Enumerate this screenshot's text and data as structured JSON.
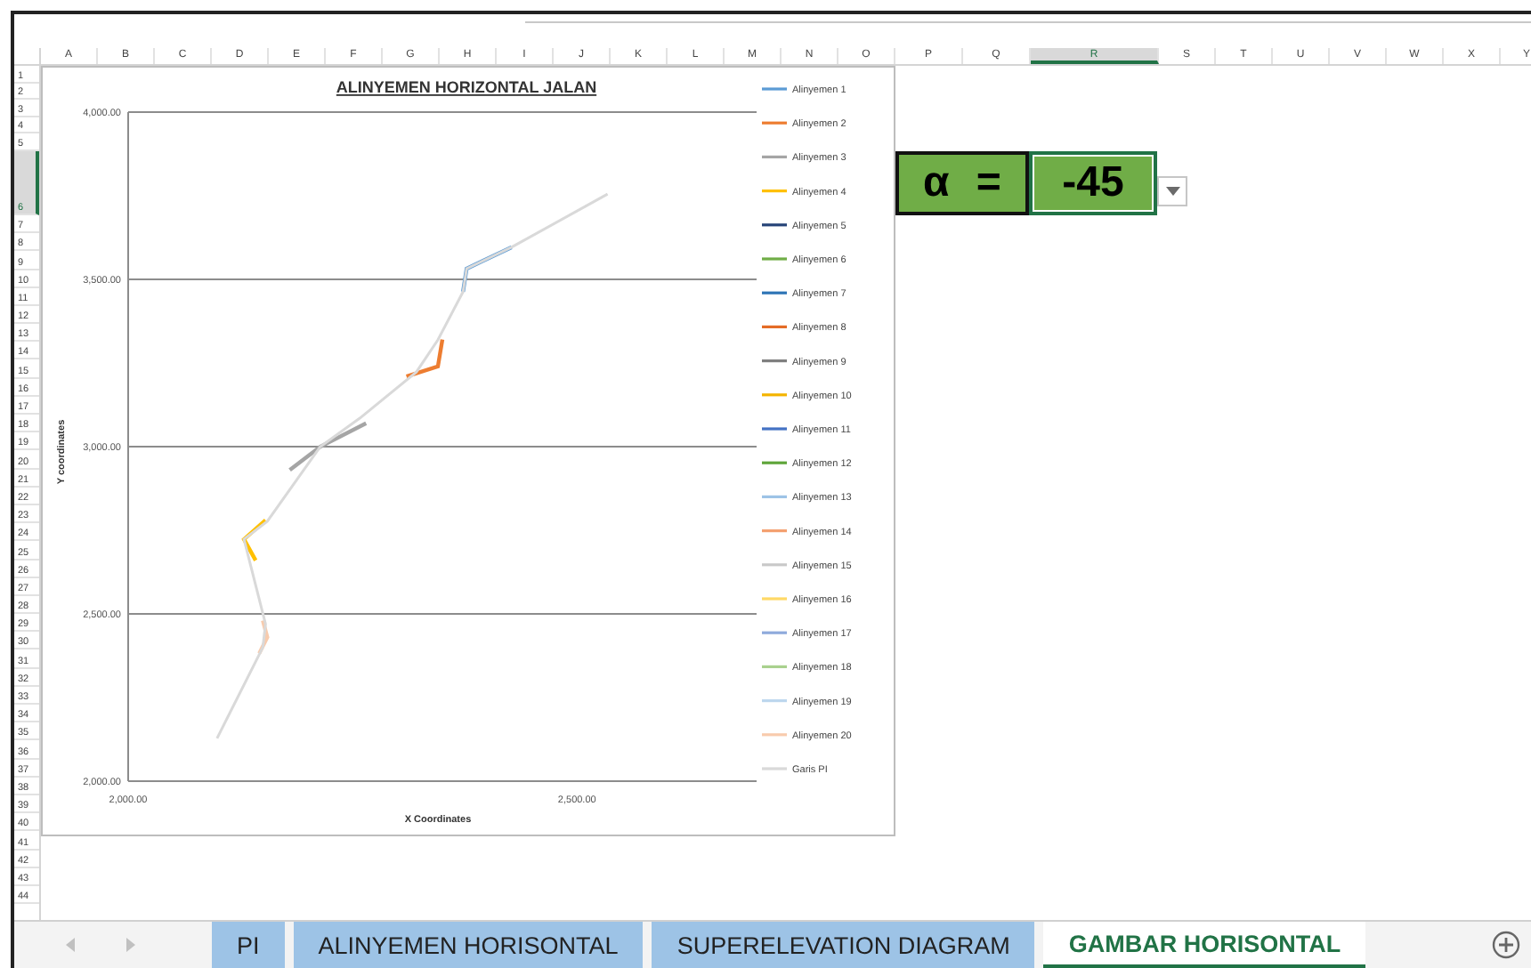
{
  "columns": [
    {
      "label": "A",
      "selected": false
    },
    {
      "label": "B",
      "selected": false
    },
    {
      "label": "C",
      "selected": false
    },
    {
      "label": "D",
      "selected": false
    },
    {
      "label": "E",
      "selected": false
    },
    {
      "label": "F",
      "selected": false
    },
    {
      "label": "G",
      "selected": false
    },
    {
      "label": "H",
      "selected": false
    },
    {
      "label": "I",
      "selected": false
    },
    {
      "label": "J",
      "selected": false
    },
    {
      "label": "K",
      "selected": false
    },
    {
      "label": "L",
      "selected": false
    },
    {
      "label": "M",
      "selected": false
    },
    {
      "label": "N",
      "selected": false
    },
    {
      "label": "O",
      "selected": false
    },
    {
      "label": "P",
      "selected": false
    },
    {
      "label": "Q",
      "selected": false
    },
    {
      "label": "R",
      "selected": true
    },
    {
      "label": "S",
      "selected": false
    },
    {
      "label": "T",
      "selected": false
    },
    {
      "label": "U",
      "selected": false
    },
    {
      "label": "V",
      "selected": false
    },
    {
      "label": "W",
      "selected": false
    },
    {
      "label": "X",
      "selected": false
    },
    {
      "label": "Y",
      "selected": false
    }
  ],
  "rows": [
    {
      "label": "1",
      "selected": false
    },
    {
      "label": "2",
      "selected": false
    },
    {
      "label": "3",
      "selected": false
    },
    {
      "label": "4",
      "selected": false
    },
    {
      "label": "5",
      "selected": false
    },
    {
      "label": "6",
      "selected": true
    },
    {
      "label": "7",
      "selected": false
    },
    {
      "label": "8",
      "selected": false
    },
    {
      "label": "9",
      "selected": false
    },
    {
      "label": "10",
      "selected": false
    },
    {
      "label": "11",
      "selected": false
    },
    {
      "label": "12",
      "selected": false
    },
    {
      "label": "13",
      "selected": false
    },
    {
      "label": "14",
      "selected": false
    },
    {
      "label": "15",
      "selected": false
    },
    {
      "label": "16",
      "selected": false
    },
    {
      "label": "17",
      "selected": false
    },
    {
      "label": "18",
      "selected": false
    },
    {
      "label": "19",
      "selected": false
    },
    {
      "label": "20",
      "selected": false
    },
    {
      "label": "21",
      "selected": false
    },
    {
      "label": "22",
      "selected": false
    },
    {
      "label": "23",
      "selected": false
    },
    {
      "label": "24",
      "selected": false
    },
    {
      "label": "25",
      "selected": false
    },
    {
      "label": "26",
      "selected": false
    },
    {
      "label": "27",
      "selected": false
    },
    {
      "label": "28",
      "selected": false
    },
    {
      "label": "29",
      "selected": false
    },
    {
      "label": "30",
      "selected": false
    },
    {
      "label": "31",
      "selected": false
    },
    {
      "label": "32",
      "selected": false
    },
    {
      "label": "33",
      "selected": false
    },
    {
      "label": "34",
      "selected": false
    },
    {
      "label": "35",
      "selected": false
    },
    {
      "label": "36",
      "selected": false
    },
    {
      "label": "37",
      "selected": false
    },
    {
      "label": "38",
      "selected": false
    },
    {
      "label": "39",
      "selected": false
    },
    {
      "label": "40",
      "selected": false
    },
    {
      "label": "41",
      "selected": false
    },
    {
      "label": "42",
      "selected": false
    },
    {
      "label": "43",
      "selected": false
    },
    {
      "label": "44",
      "selected": false
    }
  ],
  "chart": {
    "chart_data": {
      "type": "line",
      "grid": "y",
      "legend": "right",
      "title": "ALINYEMEN HORIZONTAL JALAN",
      "xlabel": "X Coordinates",
      "ylabel": "Y coordinates",
      "xlim": [
        2000,
        2700
      ],
      "ylim": [
        2000,
        4000
      ],
      "xticks": [
        {
          "value": 2000,
          "label": "2,000.00"
        },
        {
          "value": 2500,
          "label": "2,500.00"
        }
      ],
      "yticks": [
        {
          "value": 2000,
          "label": "2,000.00"
        },
        {
          "value": 2500,
          "label": "2,500.00"
        },
        {
          "value": 3000,
          "label": "3,000.00"
        },
        {
          "value": 3500,
          "label": "3,500.00"
        },
        {
          "value": 4000,
          "label": "4,000.00"
        }
      ],
      "series": [
        {
          "name": "Alinyemen 1",
          "color": "#5b9bd5",
          "x": [
            2373,
            2377,
            2395,
            2427
          ],
          "values": [
            3463,
            3532,
            3555,
            3596
          ]
        },
        {
          "name": "Alinyemen 2",
          "color": "#ed7d31",
          "x": [
            2310,
            2345,
            2350
          ],
          "values": [
            3210,
            3240,
            3320
          ]
        },
        {
          "name": "Alinyemen 3",
          "color": "#a5a5a5",
          "x": [
            2180,
            2214,
            2265
          ],
          "values": [
            2930,
            3000,
            3070
          ]
        },
        {
          "name": "Alinyemen 4",
          "color": "#ffc000",
          "x": [
            2153,
            2129,
            2142
          ],
          "values": [
            2780,
            2723,
            2660
          ]
        },
        {
          "name": "Alinyemen 5",
          "color": "#264478"
        },
        {
          "name": "Alinyemen 6",
          "color": "#70ad47"
        },
        {
          "name": "Alinyemen 7",
          "color": "#2e75b6"
        },
        {
          "name": "Alinyemen 8",
          "color": "#e46c26"
        },
        {
          "name": "Alinyemen 9",
          "color": "#7f7f7f"
        },
        {
          "name": "Alinyemen 10",
          "color": "#f4b400"
        },
        {
          "name": "Alinyemen 11",
          "color": "#4472c4"
        },
        {
          "name": "Alinyemen 12",
          "color": "#5fa53a"
        },
        {
          "name": "Alinyemen 13",
          "color": "#9dc3e6"
        },
        {
          "name": "Alinyemen 14",
          "color": "#f4a070"
        },
        {
          "name": "Alinyemen 15",
          "color": "#c9c9c9"
        },
        {
          "name": "Alinyemen 16",
          "color": "#ffd966"
        },
        {
          "name": "Alinyemen 17",
          "color": "#8faadc"
        },
        {
          "name": "Alinyemen 18",
          "color": "#a9d18e"
        },
        {
          "name": "Alinyemen 19",
          "color": "#bdd7ee"
        },
        {
          "name": "Alinyemen 20",
          "color": "#f8cbad",
          "x": [
            2146,
            2155,
            2150
          ],
          "values": [
            2382,
            2430,
            2480
          ]
        },
        {
          "name": "Garis PI",
          "color": "#d9d9d9",
          "x": [
            2099,
            2150,
            2153,
            2129,
            2155,
            2214,
            2258,
            2321,
            2345,
            2373,
            2377,
            2427,
            2534
          ],
          "values": [
            2128,
            2400,
            2470,
            2723,
            2777,
            3000,
            3085,
            3223,
            3319,
            3463,
            3532,
            3596,
            3755
          ]
        }
      ]
    }
  },
  "parameter": {
    "symbol": "α",
    "equals": "=",
    "value": "-45"
  },
  "sheet_tabs": [
    {
      "label": "PI",
      "selected": false
    },
    {
      "label": "ALINYEMEN HORISONTAL",
      "selected": false
    },
    {
      "label": "SUPERELEVATION DIAGRAM",
      "selected": false
    },
    {
      "label": "GAMBAR HORISONTAL",
      "selected": true
    }
  ]
}
